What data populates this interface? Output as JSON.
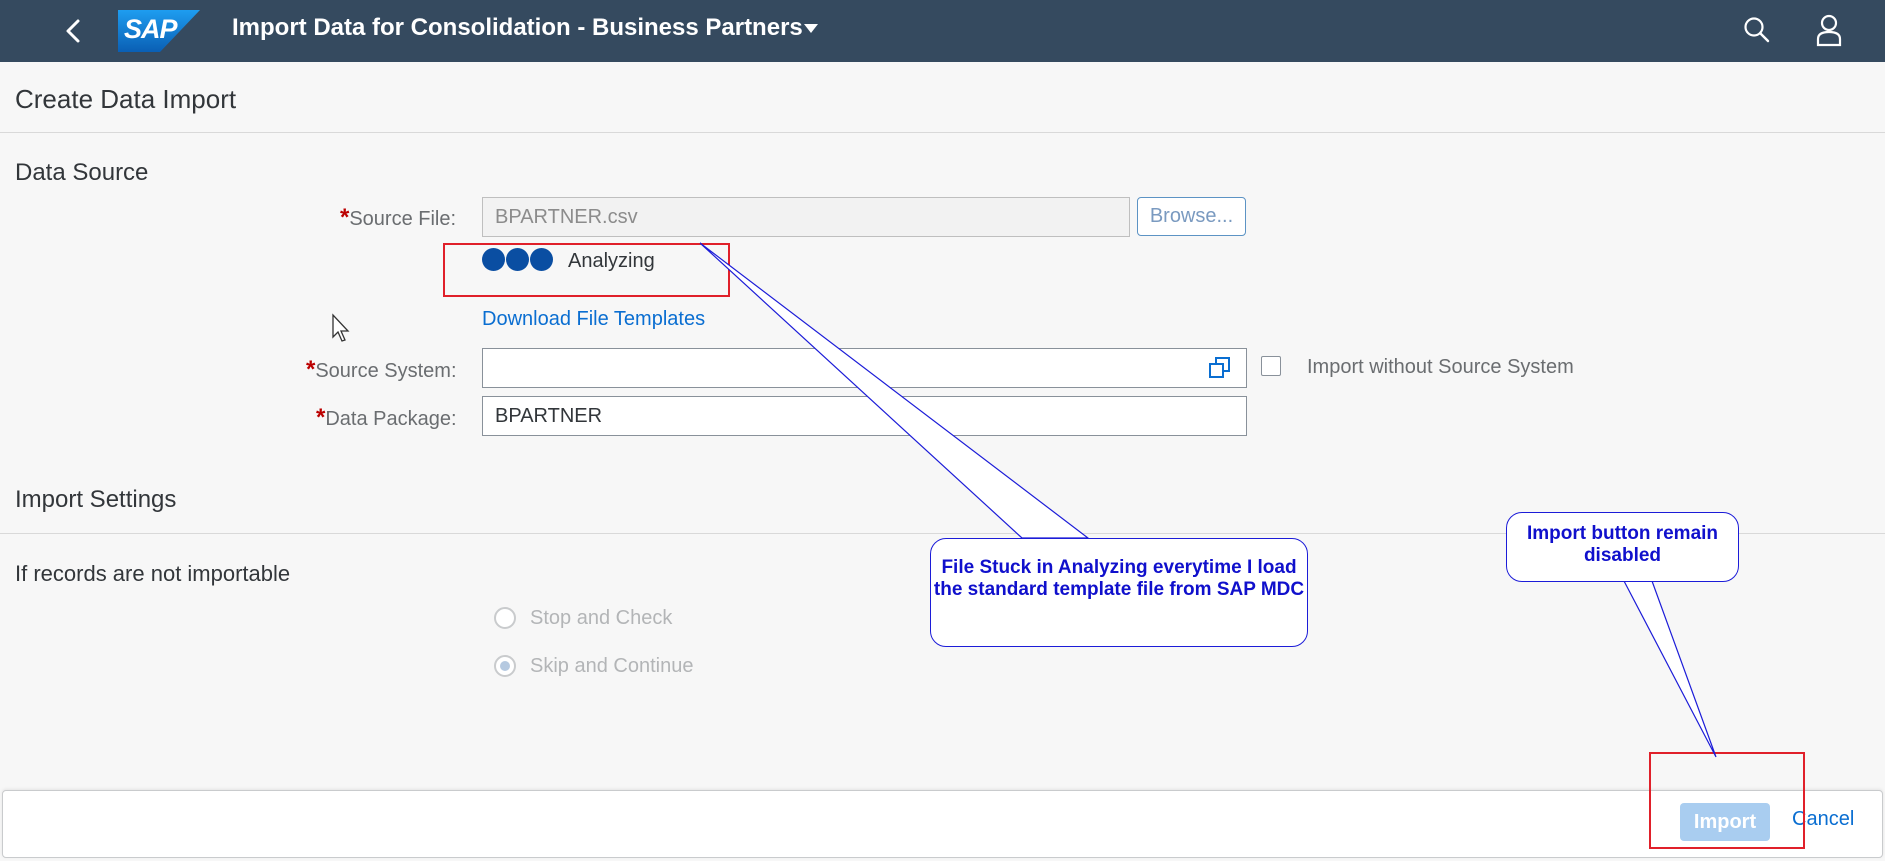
{
  "shell": {
    "logo_text": "SAP",
    "title": "Import Data for Consolidation - Business Partners",
    "icons": [
      "back-icon",
      "chevron-down-icon",
      "search-icon",
      "user-icon"
    ]
  },
  "page": {
    "heading": "Create Data Import"
  },
  "data_source": {
    "section_title": "Data Source",
    "source_file_label": "Source File:",
    "source_file_value": "BPARTNER.csv",
    "browse_label": "Browse...",
    "busy_status": "Analyzing",
    "download_link": "Download File Templates",
    "source_system_label": "Source System:",
    "source_system_value": "",
    "import_without_source_label": "Import without Source System",
    "import_without_source_checked": false,
    "data_package_label": "Data Package:",
    "data_package_value": "BPARTNER",
    "required_marker": "*"
  },
  "import_settings": {
    "section_title": "Import Settings",
    "question": "If records are not importable",
    "options": [
      {
        "label": "Stop and Check",
        "selected": false
      },
      {
        "label": "Skip and Continue",
        "selected": true
      }
    ]
  },
  "footer": {
    "import_label": "Import",
    "cancel_label": "Cancel",
    "import_enabled": false
  },
  "annotations": {
    "analyzing_callout": "File  Stuck in Analyzing everytime I load the standard template file from SAP MDC",
    "import_callout": "Import button remain disabled"
  },
  "colors": {
    "shell_bg": "#354a5f",
    "link": "#0a6ed1",
    "required": "#bb0000",
    "annotation_box": "#e0202a",
    "annotation_text": "#1010cc"
  }
}
